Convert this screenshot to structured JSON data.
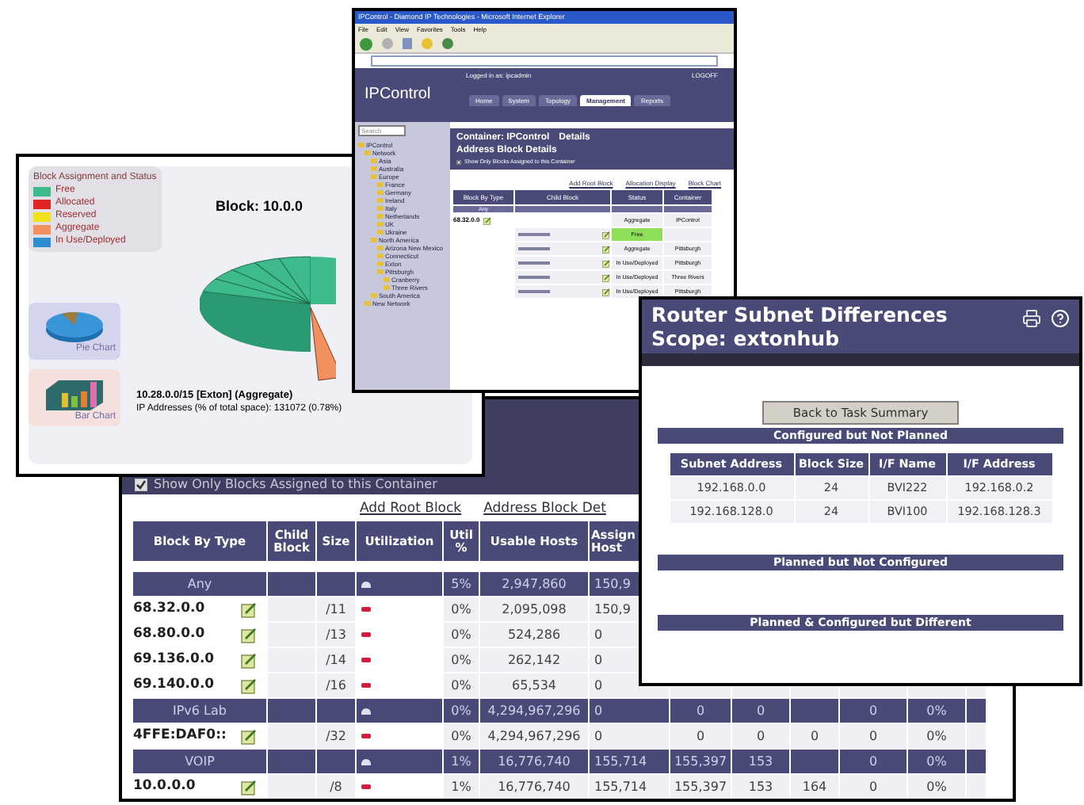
{
  "browser": {
    "title": "IPControl - Diamond IP Technologies - Microsoft Internet Explorer",
    "menu": [
      "File",
      "Edit",
      "View",
      "Favorites",
      "Tools",
      "Help"
    ],
    "logo": "IPControl",
    "login": "Logged in as: ipcadmin",
    "logoff": "LOGOFF",
    "tabs": [
      {
        "label": "Home",
        "selected": false
      },
      {
        "label": "System",
        "selected": false
      },
      {
        "label": "Topology",
        "selected": false
      },
      {
        "label": "Management",
        "selected": true
      },
      {
        "label": "Reports",
        "selected": false
      }
    ],
    "search": {
      "placeholder": "Search"
    },
    "tree": [
      {
        "label": "IPControl",
        "children": [
          {
            "label": "Network",
            "children": [
              {
                "label": "Asia"
              },
              {
                "label": "Australia"
              },
              {
                "label": "Europe",
                "children": [
                  {
                    "label": "France"
                  },
                  {
                    "label": "Germany"
                  },
                  {
                    "label": "Ireland"
                  },
                  {
                    "label": "Italy"
                  },
                  {
                    "label": "Netherlands"
                  },
                  {
                    "label": "UK"
                  },
                  {
                    "label": "Ukraine"
                  }
                ]
              },
              {
                "label": "North America",
                "children": [
                  {
                    "label": "Arizona New Mexico"
                  },
                  {
                    "label": "Connecticut"
                  },
                  {
                    "label": "Exton"
                  },
                  {
                    "label": "Pittsburgh",
                    "children": [
                      {
                        "label": "Cranberry"
                      },
                      {
                        "label": "Three Rivers"
                      }
                    ]
                  }
                ]
              },
              {
                "label": "South America"
              }
            ]
          },
          {
            "label": "New Network"
          }
        ]
      }
    ],
    "container_title": "Container: IPControl",
    "details_link": "Details",
    "subtitle": "Address Block Details",
    "show_only": {
      "label": "Show Only Blocks Assigned to this Container",
      "checked": false
    },
    "links": [
      "Add Root Block",
      "Allocation Display",
      "Block Chart"
    ],
    "columns": [
      "Block By Type",
      "Child Block",
      "Status",
      "Container"
    ],
    "group": "Any",
    "rows": [
      {
        "kind": "root",
        "block": "68.32.0.0",
        "status": "Aggregate",
        "container": "IPControl",
        "highlighted": false
      },
      {
        "kind": "child",
        "status": "Free",
        "highlighted": true
      },
      {
        "kind": "child",
        "status": "Aggregate",
        "container": "Pittsburgh",
        "highlighted": false
      },
      {
        "kind": "child",
        "status": "In Use/Deployed",
        "container": "Pittsburgh",
        "highlighted": false
      },
      {
        "kind": "child",
        "status": "In Use/Deployed",
        "container": "Three Rivers",
        "highlighted": false
      },
      {
        "kind": "child",
        "status": "In Use/Deployed",
        "container": "Pittsburgh",
        "highlighted": false
      }
    ]
  },
  "chart_window": {
    "legend": {
      "title": "Block Assignment and Status",
      "items": [
        {
          "label": "Free",
          "color": "#3dbb8c"
        },
        {
          "label": "Allocated",
          "color": "#e02424"
        },
        {
          "label": "Reserved",
          "color": "#f2e21c"
        },
        {
          "label": "Aggregate",
          "color": "#f2905e"
        },
        {
          "label": "In Use/Deployed",
          "color": "#2e8fd0"
        }
      ]
    },
    "block_label": "Block: 10.0.0",
    "thumbnails": [
      {
        "kind": "pie",
        "label": "Pie Chart"
      },
      {
        "kind": "bar",
        "label": "Bar Chart"
      }
    ],
    "caption": {
      "title": "10.28.0.0/15 [Exton] (Aggregate)",
      "text": "IP Addresses (% of total space):  131072 (0.78%)"
    }
  },
  "block_table": {
    "show_only": {
      "label": "Show Only Blocks Assigned to this Container",
      "checked": true
    },
    "links": [
      "Add Root Block",
      "Address Block Det"
    ],
    "columns": [
      "Block By Type",
      "Child Block",
      "Size",
      "Utilization",
      "Util %",
      "Usable Hosts",
      "Assign Host"
    ],
    "rows": [
      {
        "kind": "group",
        "name": "Any",
        "util_pct": "5%",
        "usable": "2,947,860",
        "assigned": "150,9"
      },
      {
        "kind": "block",
        "name": "68.32.0.0",
        "size": "/11",
        "util_pct": "0%",
        "usable": "2,095,098",
        "assigned": "150,9"
      },
      {
        "kind": "block",
        "name": "68.80.0.0",
        "size": "/13",
        "util_pct": "0%",
        "usable": "524,286",
        "assigned": "0"
      },
      {
        "kind": "block",
        "name": "69.136.0.0",
        "size": "/14",
        "util_pct": "0%",
        "usable": "262,142",
        "assigned": "0"
      },
      {
        "kind": "block",
        "name": "69.140.0.0",
        "size": "/16",
        "util_pct": "0%",
        "usable": "65,534",
        "assigned": "0"
      },
      {
        "kind": "group",
        "name": "IPv6 Lab",
        "util_pct": "0%",
        "usable": "4,294,967,296",
        "assigned": "0",
        "column_8": "0",
        "column_9": "0",
        "column_11": "0",
        "column_12": "0%"
      },
      {
        "kind": "block",
        "name": "4FFE:DAF0::",
        "size": "/32",
        "util_pct": "0%",
        "usable": "4,294,967,296",
        "assigned": "0",
        "column_8": "0",
        "column_9": "0",
        "column_10": "0",
        "column_11": "0",
        "column_12": "0%"
      },
      {
        "kind": "group",
        "name": "VOIP",
        "util_pct": "1%",
        "usable": "16,776,740",
        "assigned": "155,714",
        "column_8": "155,397",
        "column_9": "153",
        "column_11": "0",
        "column_12": "0%"
      },
      {
        "kind": "block",
        "name": "10.0.0.0",
        "size": "/8",
        "util_pct": "1%",
        "usable": "16,776,740",
        "assigned": "155,714",
        "column_8": "155,397",
        "column_9": "153",
        "column_10": "164",
        "column_11": "0",
        "column_12": "0%"
      }
    ]
  },
  "router_window": {
    "title": "Router Subnet Differences",
    "scope": "Scope: extonhub",
    "back_button": "Back to Task Summary",
    "sections": [
      {
        "title": "Configured but Not Planned",
        "columns": [
          "Subnet Address",
          "Block Size",
          "I/F Name",
          "I/F Address"
        ],
        "rows": [
          [
            "192.168.0.0",
            "24",
            "BVI222",
            "192.168.0.2"
          ],
          [
            "192.168.128.0",
            "24",
            "BVI100",
            "192.168.128.3"
          ]
        ]
      },
      {
        "title": "Planned but Not Configured"
      },
      {
        "title": "Planned & Configured but Different"
      }
    ]
  }
}
